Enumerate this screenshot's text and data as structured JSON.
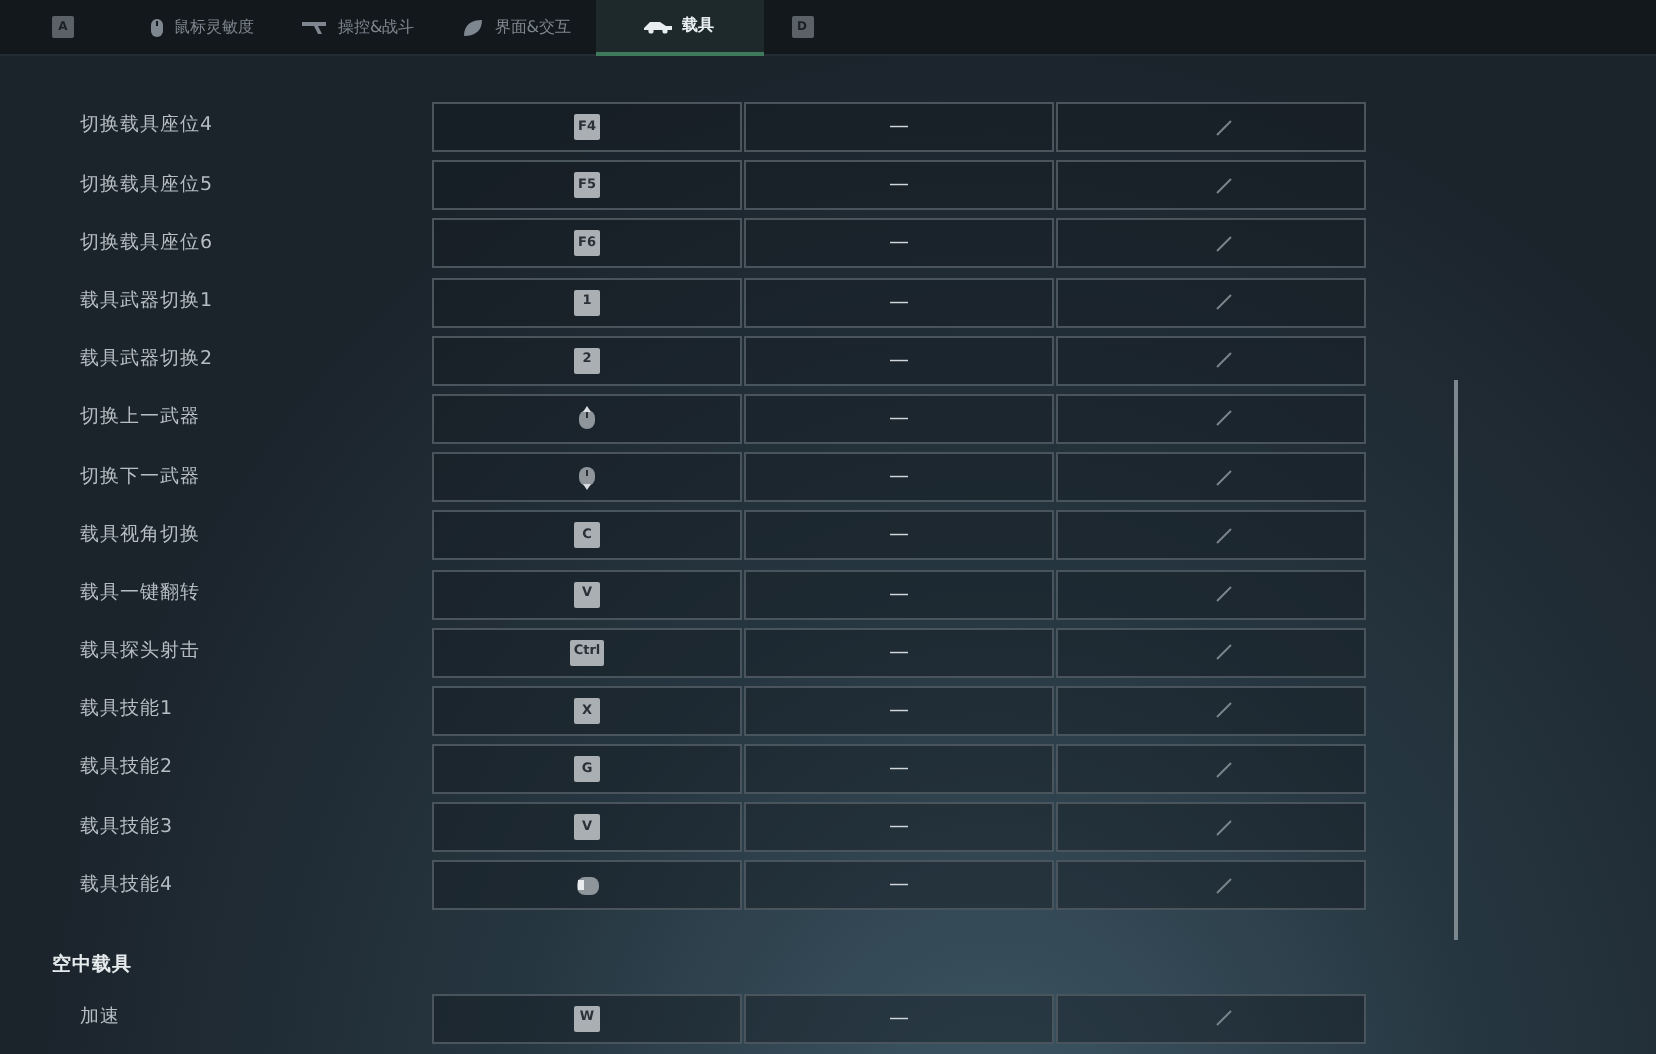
{
  "tab_bar": {
    "prev_key": "A",
    "next_key": "D",
    "tabs": [
      {
        "label": "鼠标灵敏度",
        "kind": "mouse",
        "selected": false
      },
      {
        "label": "操控&战斗",
        "kind": "gun",
        "selected": false
      },
      {
        "label": "界面&交互",
        "kind": "leaf",
        "selected": false
      },
      {
        "label": "载具",
        "kind": "car",
        "selected": true
      }
    ]
  },
  "sections": [
    {
      "rows": [
        {
          "action": "切换载具座位4",
          "binding": {
            "kind": "key",
            "label": "F4"
          },
          "secondary": "—"
        },
        {
          "action": "切换载具座位5",
          "binding": {
            "kind": "key",
            "label": "F5"
          },
          "secondary": "—"
        },
        {
          "action": "切换载具座位6",
          "binding": {
            "kind": "key",
            "label": "F6"
          },
          "secondary": "—"
        },
        {
          "action": "载具武器切换1",
          "binding": {
            "kind": "key",
            "label": "1"
          },
          "secondary": "—"
        },
        {
          "action": "载具武器切换2",
          "binding": {
            "kind": "key",
            "label": "2"
          },
          "secondary": "—"
        },
        {
          "action": "切换上一武器",
          "binding": {
            "kind": "wheel_up"
          },
          "secondary": "—"
        },
        {
          "action": "切换下一武器",
          "binding": {
            "kind": "wheel_down"
          },
          "secondary": "—"
        },
        {
          "action": "载具视角切换",
          "binding": {
            "kind": "key",
            "label": "C"
          },
          "secondary": "—"
        },
        {
          "action": "载具一键翻转",
          "binding": {
            "kind": "key",
            "label": "V"
          },
          "secondary": "—"
        },
        {
          "action": "载具探头射击",
          "binding": {
            "kind": "key",
            "label": "Ctrl"
          },
          "secondary": "—"
        },
        {
          "action": "载具技能1",
          "binding": {
            "kind": "key",
            "label": "X"
          },
          "secondary": "—"
        },
        {
          "action": "载具技能2",
          "binding": {
            "kind": "key",
            "label": "G"
          },
          "secondary": "—"
        },
        {
          "action": "载具技能3",
          "binding": {
            "kind": "key",
            "label": "V"
          },
          "secondary": "—"
        },
        {
          "action": "载具技能4",
          "binding": {
            "kind": "mouse_side"
          },
          "secondary": "—"
        }
      ]
    },
    {
      "title": "空中载具",
      "rows": [
        {
          "action": "加速",
          "binding": {
            "kind": "key",
            "label": "W"
          },
          "secondary": "—"
        }
      ]
    }
  ]
}
